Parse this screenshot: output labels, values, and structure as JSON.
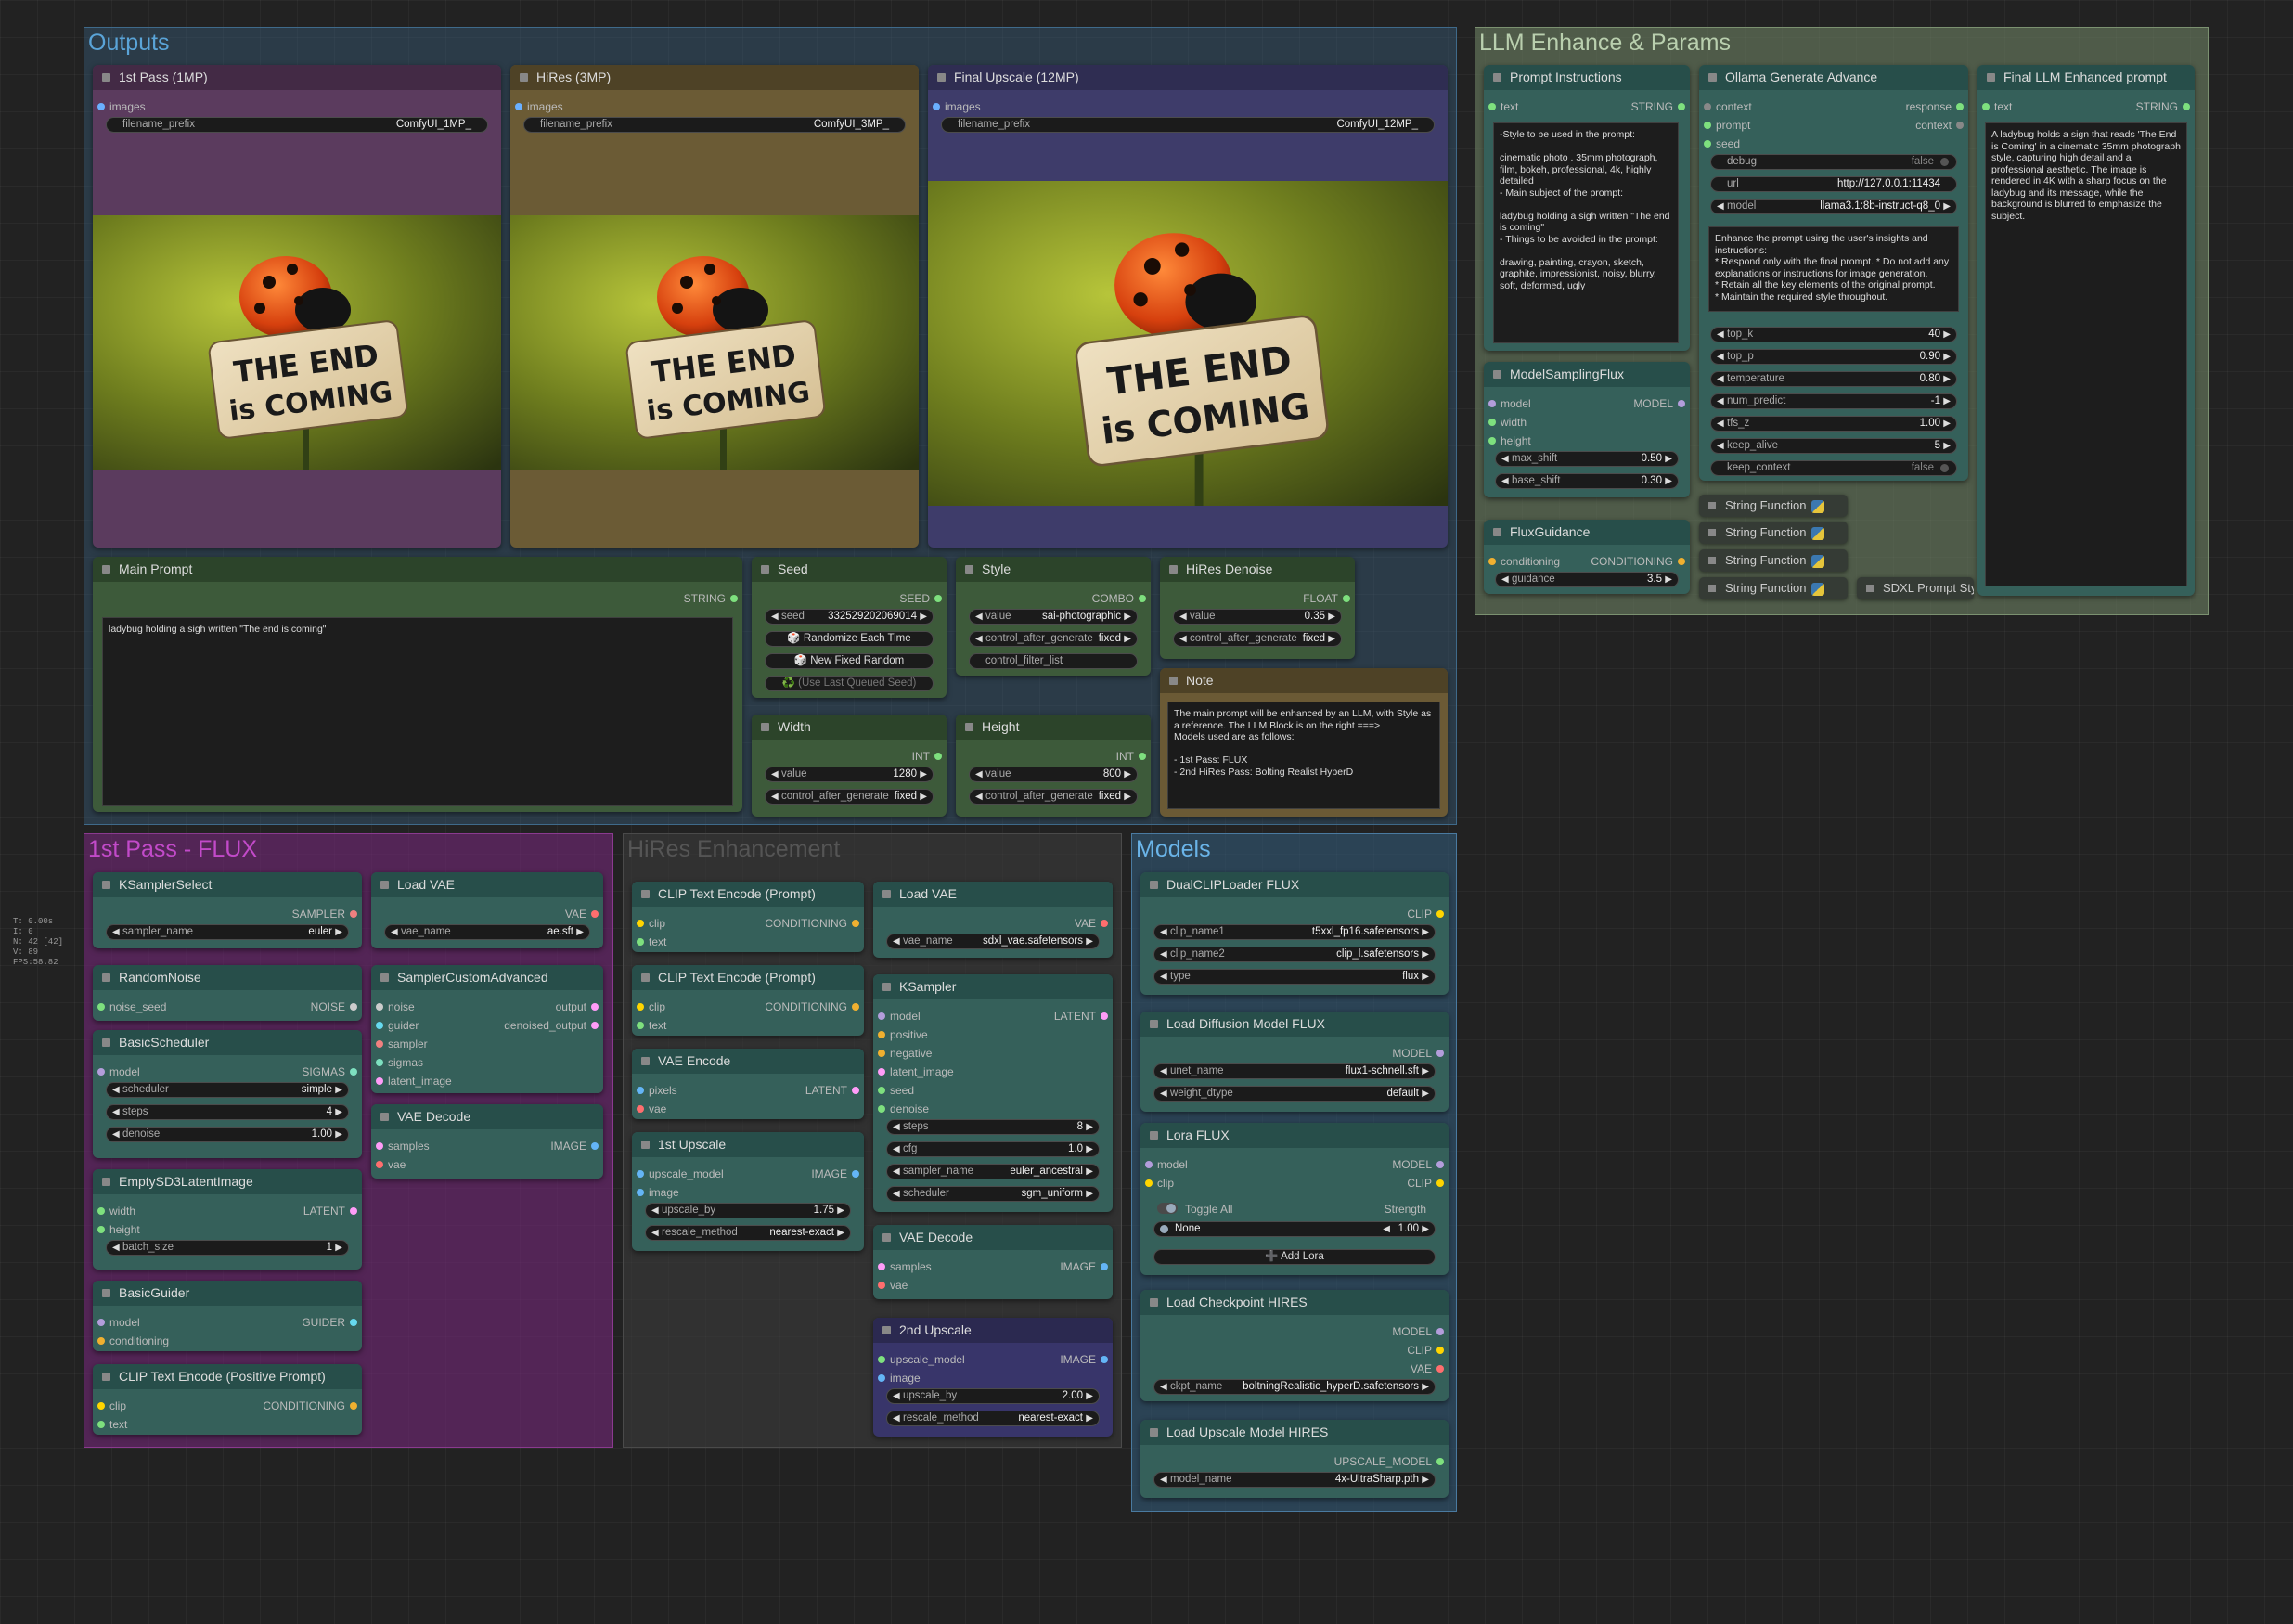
{
  "stats": {
    "time": "T: 0.00s",
    "i": "I: 0",
    "n": "N: 42 [42]",
    "v": "V: 89",
    "fps": "FPS:58.82"
  },
  "groups": {
    "outputs": "Outputs",
    "llm": "LLM Enhance & Params",
    "flux": "1st Pass - FLUX",
    "hires": "HiRes Enhancement",
    "models": "Models"
  },
  "outputs": [
    {
      "title": "1st Pass (1MP)",
      "input": "images",
      "widget_label": "filename_prefix",
      "widget_value": "ComfyUI_1MP_"
    },
    {
      "title": "HiRes (3MP)",
      "input": "images",
      "widget_label": "filename_prefix",
      "widget_value": "ComfyUI_3MP_"
    },
    {
      "title": "Final Upscale (12MP)",
      "input": "images",
      "widget_label": "filename_prefix",
      "widget_value": "ComfyUI_12MP_"
    }
  ],
  "sign": {
    "line1": "THE END",
    "line2": "is COMING"
  },
  "main_prompt": {
    "title": "Main Prompt",
    "output": "STRING",
    "text": "ladybug holding a sigh written \"The end is coming\""
  },
  "seed": {
    "title": "Seed",
    "output": "SEED",
    "label": "seed",
    "value": "332529202069014",
    "btn1": "🎲 Randomize Each Time",
    "btn2": "🎲 New Fixed Random",
    "btn3": "♻️ (Use Last Queued Seed)"
  },
  "style": {
    "title": "Style",
    "output": "COMBO",
    "label": "value",
    "value": "sai-photographic",
    "ctrl_label": "control_after_generate",
    "ctrl_value": "fixed",
    "filter": "control_filter_list"
  },
  "hires_denoise": {
    "title": "HiRes Denoise",
    "output": "FLOAT",
    "label": "value",
    "value": "0.35",
    "ctrl_label": "control_after_generate",
    "ctrl_value": "fixed"
  },
  "width": {
    "title": "Width",
    "output": "INT",
    "label": "value",
    "value": "1280",
    "ctrl_label": "control_after_generate",
    "ctrl_value": "fixed"
  },
  "height": {
    "title": "Height",
    "output": "INT",
    "label": "value",
    "value": "800",
    "ctrl_label": "control_after_generate",
    "ctrl_value": "fixed"
  },
  "note": {
    "title": "Note",
    "text": "The main prompt will be enhanced by an LLM, with Style as a reference. The LLM Block is on the right ===>\nModels used are as follows:\n\n- 1st Pass: FLUX\n- 2nd HiRes Pass: Bolting Realist HyperD"
  },
  "prompt_instr": {
    "title": "Prompt Instructions",
    "input": "text",
    "output": "STRING",
    "text": "-Style to be used in the prompt:\n\ncinematic photo . 35mm photograph, film, bokeh, professional, 4k, highly detailed\n- Main subject of the prompt:\n\nladybug holding a sigh written \"The end is coming\"\n- Things to be avoided in the prompt:\n\ndrawing, painting, crayon, sketch, graphite, impressionist, noisy, blurry, soft, deformed, ugly"
  },
  "ollama": {
    "title": "Ollama Generate Advance",
    "in1": "context",
    "in2": "prompt",
    "in3": "seed",
    "out1": "response",
    "out2": "context",
    "debug_label": "debug",
    "debug_value": "false",
    "url_label": "url",
    "url_value": "http://127.0.0.1:11434",
    "model_label": "model",
    "model_value": "llama3.1:8b-instruct-q8_0",
    "sys_text": "Enhance the prompt using the user's insights and instructions:\n* Respond only with the final prompt. * Do not add any explanations or instructions for image generation.\n* Retain all the key elements of the original prompt.\n* Maintain the required style throughout.",
    "params": [
      {
        "label": "top_k",
        "value": "40"
      },
      {
        "label": "top_p",
        "value": "0.90"
      },
      {
        "label": "temperature",
        "value": "0.80"
      },
      {
        "label": "num_predict",
        "value": "-1"
      },
      {
        "label": "tfs_z",
        "value": "1.00"
      },
      {
        "label": "keep_alive",
        "value": "5"
      }
    ],
    "keep_label": "keep_context",
    "keep_value": "false"
  },
  "final_llm": {
    "title": "Final LLM Enhanced prompt",
    "input": "text",
    "output": "STRING",
    "text": "A ladybug holds a sign that reads 'The End is Coming' in a cinematic 35mm photograph style, capturing high detail and a professional aesthetic. The image is rendered in 4K with a sharp focus on the ladybug and its message, while the background is blurred to emphasize the subject."
  },
  "msf": {
    "title": "ModelSamplingFlux",
    "in1": "model",
    "in2": "width",
    "in3": "height",
    "out": "MODEL",
    "w1_label": "max_shift",
    "w1_value": "0.50",
    "w2_label": "base_shift",
    "w2_value": "0.30"
  },
  "flux_guid": {
    "title": "FluxGuidance",
    "in": "conditioning",
    "out": "CONDITIONING",
    "w_label": "guidance",
    "w_value": "3.5"
  },
  "string_funcs": [
    "String Function",
    "String Function",
    "String Function",
    "String Function"
  ],
  "sdxl_style": "SDXL Prompt Styler",
  "flux": {
    "ksel": {
      "title": "KSamplerSelect",
      "out": "SAMPLER",
      "w_label": "sampler_name",
      "w_value": "euler"
    },
    "rnoise": {
      "title": "RandomNoise",
      "in": "noise_seed",
      "out": "NOISE"
    },
    "bsched": {
      "title": "BasicScheduler",
      "in": "model",
      "out": "SIGMAS",
      "w1_label": "scheduler",
      "w1_value": "simple",
      "w2_label": "steps",
      "w2_value": "4",
      "w3_label": "denoise",
      "w3_value": "1.00"
    },
    "empty": {
      "title": "EmptySD3LatentImage",
      "in1": "width",
      "in2": "height",
      "out": "LATENT",
      "w_label": "batch_size",
      "w_value": "1"
    },
    "bguider": {
      "title": "BasicGuider",
      "in1": "model",
      "in2": "conditioning",
      "out": "GUIDER"
    },
    "clipenc": {
      "title": "CLIP Text Encode (Positive Prompt)",
      "in1": "clip",
      "in2": "text",
      "out": "CONDITIONING"
    },
    "vae": {
      "title": "Load VAE",
      "out": "VAE",
      "w_label": "vae_name",
      "w_value": "ae.sft"
    },
    "sca": {
      "title": "SamplerCustomAdvanced",
      "in1": "noise",
      "in2": "guider",
      "in3": "sampler",
      "in4": "sigmas",
      "in5": "latent_image",
      "out1": "output",
      "out2": "denoised_output"
    },
    "vaedec": {
      "title": "VAE Decode",
      "in1": "samples",
      "in2": "vae",
      "out": "IMAGE"
    }
  },
  "hires": {
    "clip1": {
      "title": "CLIP Text Encode (Prompt)",
      "in1": "clip",
      "in2": "text",
      "out": "CONDITIONING"
    },
    "clip2": {
      "title": "CLIP Text Encode (Prompt)",
      "in1": "clip",
      "in2": "text",
      "out": "CONDITIONING"
    },
    "vaeenc": {
      "title": "VAE Encode",
      "in1": "pixels",
      "in2": "vae",
      "out": "LATENT"
    },
    "up1": {
      "title": "1st Upscale",
      "in1": "upscale_model",
      "in2": "image",
      "out": "IMAGE",
      "w1_label": "upscale_by",
      "w1_value": "1.75",
      "w2_label": "rescale_method",
      "w2_value": "nearest-exact"
    },
    "vae": {
      "title": "Load VAE",
      "out": "VAE",
      "w_label": "vae_name",
      "w_value": "sdxl_vae.safetensors"
    },
    "ks": {
      "title": "KSampler",
      "ins": [
        "model",
        "positive",
        "negative",
        "latent_image",
        "seed",
        "denoise"
      ],
      "out": "LATENT",
      "w": [
        {
          "label": "steps",
          "value": "8"
        },
        {
          "label": "cfg",
          "value": "1.0"
        },
        {
          "label": "sampler_name",
          "value": "euler_ancestral"
        },
        {
          "label": "scheduler",
          "value": "sgm_uniform"
        }
      ]
    },
    "vaedec": {
      "title": "VAE Decode",
      "in1": "samples",
      "in2": "vae",
      "out": "IMAGE"
    },
    "up2": {
      "title": "2nd Upscale",
      "in1": "upscale_model",
      "in2": "image",
      "out": "IMAGE",
      "w1_label": "upscale_by",
      "w1_value": "2.00",
      "w2_label": "rescale_method",
      "w2_value": "nearest-exact"
    }
  },
  "models": {
    "dual": {
      "title": "DualCLIPLoader FLUX",
      "out": "CLIP",
      "w": [
        {
          "label": "clip_name1",
          "value": "t5xxl_fp16.safetensors"
        },
        {
          "label": "clip_name2",
          "value": "clip_l.safetensors"
        },
        {
          "label": "type",
          "value": "flux"
        }
      ]
    },
    "diff": {
      "title": "Load Diffusion Model FLUX",
      "out": "MODEL",
      "w": [
        {
          "label": "unet_name",
          "value": "flux1-schnell.sft"
        },
        {
          "label": "weight_dtype",
          "value": "default"
        }
      ]
    },
    "lora": {
      "title": "Lora FLUX",
      "in1": "model",
      "in2": "clip",
      "out1": "MODEL",
      "out2": "CLIP",
      "toggle": "Toggle All",
      "strength": "Strength",
      "lora_name": "None",
      "lora_value": "1.00",
      "add": "➕ Add Lora"
    },
    "ckpt": {
      "title": "Load Checkpoint HIRES",
      "out1": "MODEL",
      "out2": "CLIP",
      "out3": "VAE",
      "w_label": "ckpt_name",
      "w_value": "boltningRealistic_hyperD.safetensors"
    },
    "upm": {
      "title": "Load Upscale Model HIRES",
      "out": "UPSCALE_MODEL",
      "w_label": "model_name",
      "w_value": "4x-UltraSharp.pth"
    }
  },
  "colors": {
    "outputs_group": "#2f4556",
    "llm_group": "#4e5b4a",
    "flux_group": "#4a2a4f",
    "hires_group": "#3a3a3a",
    "models_group": "#2d4a5c",
    "node": "#35605a",
    "node_header": "#274e4a"
  }
}
